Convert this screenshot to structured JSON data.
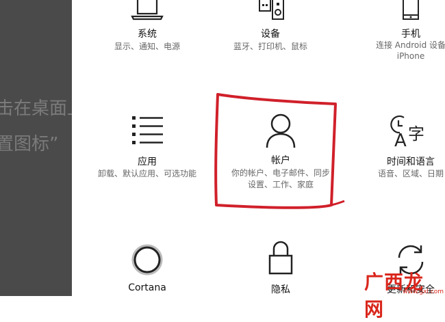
{
  "background_panel": {
    "line1": "击在桌面上",
    "line2": "置图标”"
  },
  "tiles": {
    "system": {
      "label": "系统",
      "desc": "显示、通知、电源",
      "icon": "laptop-icon"
    },
    "devices": {
      "label": "设备",
      "desc": "蓝牙、打印机、鼠标",
      "icon": "keyboard-speaker-icon"
    },
    "phone": {
      "label": "手机",
      "desc1": "连接 Android 设备",
      "desc2": "iPhone",
      "icon": "phone-icon"
    },
    "apps": {
      "label": "应用",
      "desc": "卸载、默认应用、可选功能",
      "icon": "list-icon"
    },
    "accounts": {
      "label": "帐户",
      "desc1": "你的帐户、电子邮件、同步",
      "desc2": "设置、工作、家庭",
      "icon": "person-icon"
    },
    "time": {
      "label": "时间和语言",
      "desc": "语音、区域、日期",
      "icon": "time-language-icon"
    },
    "cortana": {
      "label": "Cortana",
      "icon": "cortana-circle-icon"
    },
    "privacy": {
      "label": "隐私",
      "icon": "lock-icon"
    },
    "update": {
      "label": "更新和安全",
      "icon": "refresh-icon"
    }
  },
  "annotation": {
    "color": "#d0202a"
  },
  "watermark": {
    "main": "广西龙网",
    "sub": "www.gxl.com"
  }
}
